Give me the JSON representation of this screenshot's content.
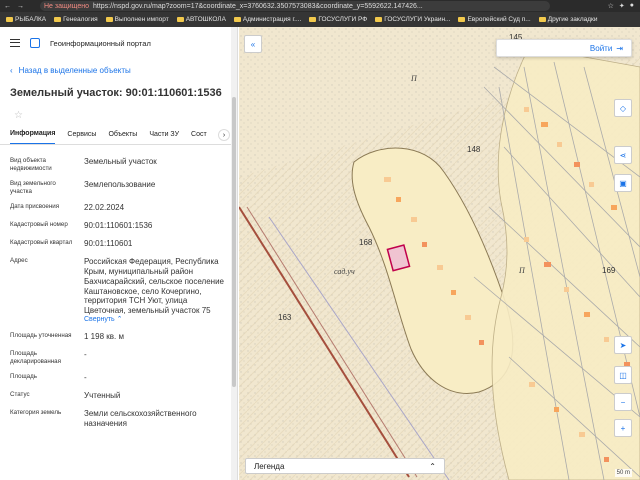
{
  "browser": {
    "insecure_label": "Не защищено",
    "url": "https://nspd.gov.ru/map?zoom=17&coordinate_x=3760632.3507573083&coordinate_y=5592622.147426...",
    "bookmarks": [
      "РЫБАЛКА",
      "Генеалогия",
      "Выполнен импорт",
      "АВТОШКОЛА",
      "Администрация г....",
      "ГОСУСЛУГИ РФ",
      "ГОСУСЛУГИ Украин...",
      "Европейский Суд п...",
      "Другие закладки"
    ]
  },
  "panel": {
    "portal_title": "Геоинформационный портал",
    "back_label": "Назад в выделенные объекты",
    "object_title": "Земельный участок: 90:01:110601:1536",
    "tabs": [
      "Информация",
      "Сервисы",
      "Объекты",
      "Части ЗУ",
      "Сост"
    ],
    "rows": [
      {
        "label": "Вид объекта недвижимости",
        "value": "Земельный участок"
      },
      {
        "label": "Вид земельного участка",
        "value": "Землепользование"
      },
      {
        "label": "Дата присвоения",
        "value": "22.02.2024"
      },
      {
        "label": "Кадастровый номер",
        "value": "90:01:110601:1536"
      },
      {
        "label": "Кадастровый квартал",
        "value": "90:01:110601"
      },
      {
        "label": "Адрес",
        "value": "Российская Федерация, Республика Крым, муниципальный район Бахчисарайский, сельское поселение Каштановское, село Кочергино, территория ТСН Уют, улица Цветочная, земельный участок 75"
      },
      {
        "label": "Площадь уточненная",
        "value": "1 198 кв. м"
      },
      {
        "label": "Площадь декларированная",
        "value": "-"
      },
      {
        "label": "Площадь",
        "value": "-"
      },
      {
        "label": "Статус",
        "value": "Учтенный"
      },
      {
        "label": "Категория земель",
        "value": "Земли сельскохозяйственного назначения"
      }
    ],
    "collapse_label": "Свернуть"
  },
  "map": {
    "search_label": "Войти",
    "legend_label": "Легенда",
    "labels": [
      "145",
      "148",
      "168",
      "169",
      "163",
      "П",
      "П",
      "сад.уч"
    ],
    "scale_label": "50 m"
  },
  "colors": {
    "accent": "#1a73e8",
    "map_base": "#f3ebd6",
    "road": "#a54f3d",
    "parcel": "#f8ca93",
    "selected": "#c0004c"
  }
}
